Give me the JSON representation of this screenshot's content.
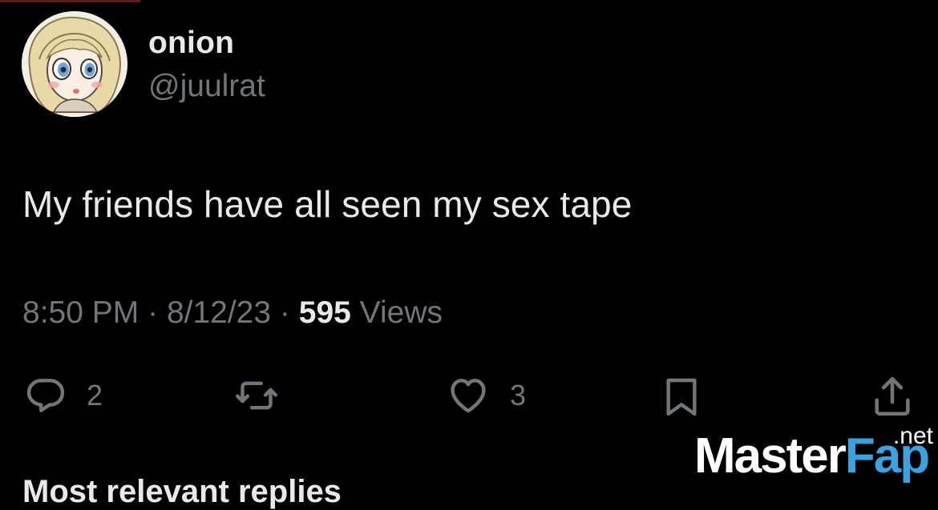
{
  "tweet": {
    "display_name": "onion",
    "handle": "@juulrat",
    "text": "My friends have all seen my sex tape",
    "time": "8:50 PM",
    "date": "8/12/23",
    "separator": "·",
    "views_count": "595",
    "views_label": "Views"
  },
  "actions": {
    "reply": {
      "icon": "reply-icon",
      "count": "2"
    },
    "retweet": {
      "icon": "retweet-icon"
    },
    "like": {
      "icon": "heart-icon",
      "count": "3"
    },
    "bookmark": {
      "icon": "bookmark-icon"
    },
    "share": {
      "icon": "share-icon"
    }
  },
  "replies_header": "Most relevant replies",
  "watermark": {
    "part1": "Master",
    "part2": "Fap",
    "tld": ".net"
  },
  "colors": {
    "background": "#000000",
    "primary_text": "#e7e9ea",
    "secondary_text": "#71767b",
    "watermark_accent": "#3aa3df"
  }
}
